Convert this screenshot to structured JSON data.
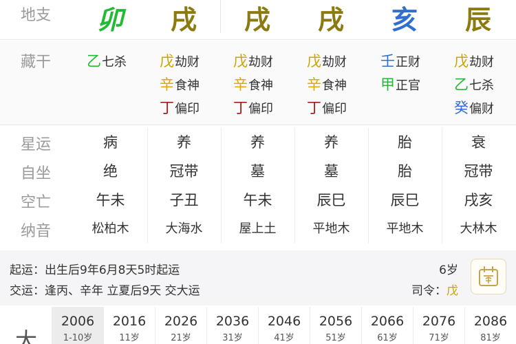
{
  "labels": {
    "dizhi": "地支",
    "canggan": "藏干",
    "xingyun": "星运",
    "zizuo": "自坐",
    "kongwang": "空亡",
    "nayin": "纳音",
    "dayun": "大"
  },
  "colors": {
    "wood": "#22bb33",
    "earth": "#8a7a10",
    "water": "#2f6fcf",
    "metal": "#d9a200",
    "fire": "#8b1a1a"
  },
  "dizhi": [
    {
      "char": "卯",
      "color": "#22bb33"
    },
    {
      "char": "戌",
      "color": "#8a7a10"
    },
    {
      "char": "戌",
      "color": "#8a7a10"
    },
    {
      "char": "戌",
      "color": "#8a7a10"
    },
    {
      "char": "亥",
      "color": "#2f6fcf"
    },
    {
      "char": "辰",
      "color": "#8a7a10"
    }
  ],
  "canggan": [
    [
      {
        "stem": "乙",
        "god": "七杀",
        "color": "#22bb33"
      }
    ],
    [
      {
        "stem": "戊",
        "god": "劫财",
        "color": "#c9a300"
      },
      {
        "stem": "辛",
        "god": "食神",
        "color": "#e0a800"
      },
      {
        "stem": "丁",
        "god": "偏印",
        "color": "#a0201a"
      }
    ],
    [
      {
        "stem": "戊",
        "god": "劫财",
        "color": "#c9a300"
      },
      {
        "stem": "辛",
        "god": "食神",
        "color": "#e0a800"
      },
      {
        "stem": "丁",
        "god": "偏印",
        "color": "#a0201a"
      }
    ],
    [
      {
        "stem": "戊",
        "god": "劫财",
        "color": "#c9a300"
      },
      {
        "stem": "辛",
        "god": "食神",
        "color": "#e0a800"
      },
      {
        "stem": "丁",
        "god": "偏印",
        "color": "#a0201a"
      }
    ],
    [
      {
        "stem": "壬",
        "god": "正财",
        "color": "#2f6fcf"
      },
      {
        "stem": "甲",
        "god": "正官",
        "color": "#22bb33"
      }
    ],
    [
      {
        "stem": "戊",
        "god": "劫财",
        "color": "#c9a300"
      },
      {
        "stem": "乙",
        "god": "七杀",
        "color": "#22bb33"
      },
      {
        "stem": "癸",
        "god": "偏财",
        "color": "#2f6fcf"
      }
    ]
  ],
  "xingyun": [
    "病",
    "养",
    "养",
    "养",
    "胎",
    "衰"
  ],
  "zizuo": [
    "绝",
    "冠带",
    "墓",
    "墓",
    "胎",
    "冠带"
  ],
  "kongwang": [
    "午未",
    "子丑",
    "午未",
    "辰巳",
    "辰巳",
    "戌亥"
  ],
  "nayin": [
    "松柏木",
    "大海水",
    "屋上土",
    "平地木",
    "平地木",
    "大林木"
  ],
  "yun": {
    "qiyun_label": "起运：",
    "qiyun_text": "出生后9年6月8天5时起运",
    "age": "6岁",
    "jiaoyun_label": "交运：",
    "jiaoyun_text": "逢丙、辛年 立夏后9天 交大运",
    "siling_label": "司令：",
    "siling_value": "戊",
    "siling_color": "#c9a300"
  },
  "dayun": [
    {
      "year": "2006",
      "age": "1-10岁",
      "active": true
    },
    {
      "year": "2016",
      "age": "11岁",
      "active": false
    },
    {
      "year": "2026",
      "age": "21岁",
      "active": false
    },
    {
      "year": "2036",
      "age": "31岁",
      "active": false
    },
    {
      "year": "2046",
      "age": "41岁",
      "active": false
    },
    {
      "year": "2056",
      "age": "51岁",
      "active": false
    },
    {
      "year": "2066",
      "age": "61岁",
      "active": false
    },
    {
      "year": "2076",
      "age": "71岁",
      "active": false
    },
    {
      "year": "2086",
      "age": "81岁",
      "active": false
    }
  ]
}
